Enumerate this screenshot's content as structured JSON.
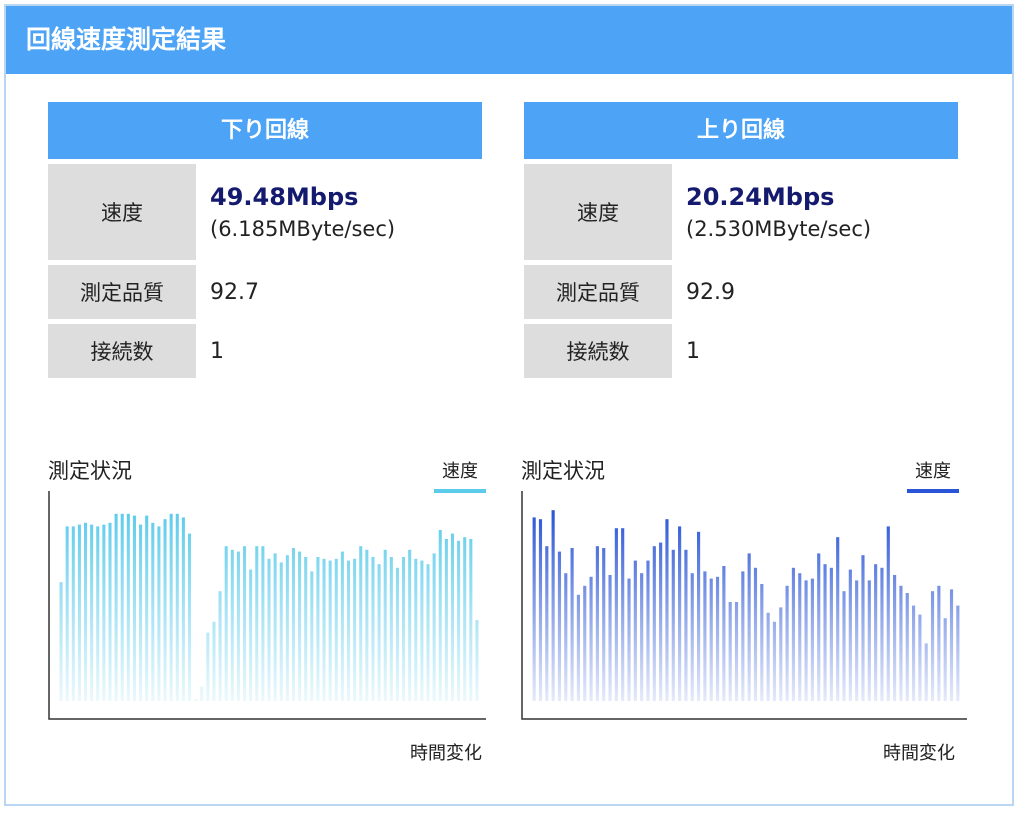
{
  "header": {
    "title": "回線速度測定結果"
  },
  "download": {
    "title": "下り回線",
    "speed_label": "速度",
    "speed_main": "49.48Mbps",
    "speed_sub": "(6.185MByte/sec)",
    "quality_label": "測定品質",
    "quality_value": "92.7",
    "connections_label": "接続数",
    "connections_value": "1"
  },
  "upload": {
    "title": "上り回線",
    "speed_label": "速度",
    "speed_main": "20.24Mbps",
    "speed_sub": "(2.530MByte/sec)",
    "quality_label": "測定品質",
    "quality_value": "92.9",
    "connections_label": "接続数",
    "connections_value": "1"
  },
  "chart_data": [
    {
      "type": "bar",
      "title": "測定状況",
      "xlabel": "時間変化",
      "ylabel": "",
      "legend": [
        "速度"
      ],
      "legend_position": "top-right",
      "grid": false,
      "ylim": [
        0,
        1
      ],
      "color": "#5bcbeb",
      "series": [
        {
          "name": "速度",
          "values": [
            0.66,
            0.97,
            0.97,
            0.98,
            0.99,
            0.98,
            0.97,
            0.98,
            0.99,
            1.04,
            1.04,
            1.04,
            1.03,
            0.98,
            1.03,
            0.99,
            0.97,
            1.01,
            1.04,
            1.04,
            1.02,
            0.93,
            0.0,
            0.08,
            0.38,
            0.44,
            0.61,
            0.86,
            0.84,
            0.83,
            0.86,
            0.73,
            0.86,
            0.86,
            0.79,
            0.82,
            0.77,
            0.81,
            0.85,
            0.83,
            0.8,
            0.72,
            0.8,
            0.79,
            0.78,
            0.79,
            0.83,
            0.78,
            0.79,
            0.86,
            0.84,
            0.8,
            0.76,
            0.84,
            0.8,
            0.74,
            0.8,
            0.84,
            0.79,
            0.78,
            0.76,
            0.82,
            0.95,
            0.9,
            0.93,
            0.89,
            0.91,
            0.9,
            0.45
          ]
        }
      ]
    },
    {
      "type": "bar",
      "title": "測定状況",
      "xlabel": "時間変化",
      "ylabel": "",
      "legend": [
        "速度"
      ],
      "legend_position": "top-right",
      "grid": false,
      "ylim": [
        0,
        1
      ],
      "color": "#2a55d6",
      "series": [
        {
          "name": "速度",
          "values": [
            1.02,
            1.01,
            0.86,
            1.06,
            0.83,
            0.71,
            0.85,
            0.59,
            0.64,
            0.69,
            0.86,
            0.85,
            0.7,
            0.96,
            0.96,
            0.68,
            0.78,
            0.71,
            0.78,
            0.86,
            0.88,
            1.01,
            0.84,
            0.97,
            0.84,
            0.71,
            0.94,
            0.72,
            0.68,
            0.69,
            0.75,
            0.55,
            0.55,
            0.72,
            0.82,
            0.74,
            0.65,
            0.49,
            0.44,
            0.52,
            0.64,
            0.74,
            0.71,
            0.67,
            0.68,
            0.82,
            0.76,
            0.74,
            0.91,
            0.61,
            0.73,
            0.67,
            0.81,
            0.67,
            0.76,
            0.74,
            0.97,
            0.7,
            0.64,
            0.6,
            0.53,
            0.48,
            0.32,
            0.61,
            0.64,
            0.46,
            0.62,
            0.53
          ]
        }
      ]
    }
  ]
}
